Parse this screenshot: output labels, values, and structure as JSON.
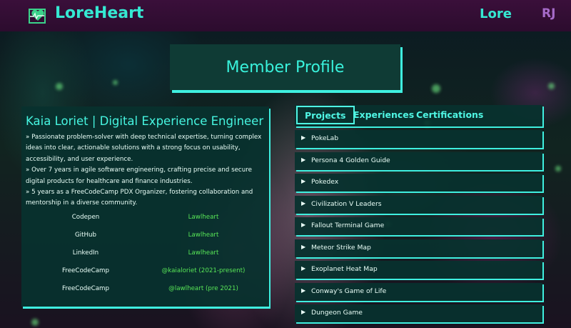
{
  "header": {
    "brand_part1": "Lore",
    "brand_part2": "Heart",
    "nav_lore": "Lore",
    "nav_user": "RJ"
  },
  "page": {
    "title": "Member Profile"
  },
  "profile": {
    "name": "Kaia Loriet | Digital Experience Engineer",
    "bio": [
      "» Passionate problem-solver with deep technical expertise, turning complex ideas into clear, actionable solutions with a strong focus on usability, accessibility, and user experience.",
      "» Over 7 years in agile software engineering, crafting precise and secure digital products for healthcare and finance industries.",
      "» 5 years as a FreeCodeCamp PDX Organizer, fostering collaboration and mentorship in a diverse community."
    ],
    "links": [
      {
        "site": "Codepen",
        "handle": "Lawlheart"
      },
      {
        "site": "GitHub",
        "handle": "Lawlheart"
      },
      {
        "site": "LinkedIn",
        "handle": "Lawlheart"
      },
      {
        "site": "FreeCodeCamp",
        "handle": "@kaialoriet (2021-present)"
      },
      {
        "site": "FreeCodeCamp",
        "handle": "@lawlheart (pre 2021)"
      }
    ]
  },
  "tabs": [
    "Projects",
    "Experiences",
    "Certifications"
  ],
  "active_tab": "Projects",
  "projects": [
    "PokeLab",
    "Persona 4 Golden Guide",
    "Pokedex",
    "Civilization V Leaders",
    "Fallout Terminal Game",
    "Meteor Strike Map",
    "Exoplanet Heat Map",
    "Conway's Game of Life",
    "Dungeon Game"
  ],
  "icons": {
    "logo": "heart-monitor-logo-icon",
    "caret": "caret-right-icon"
  },
  "colors": {
    "accent": "#3ff0e0",
    "header_bg": "#3a0f3a",
    "panel_bg": "#08322e",
    "link_green": "#58e657",
    "user_purple": "#a66bc9"
  }
}
